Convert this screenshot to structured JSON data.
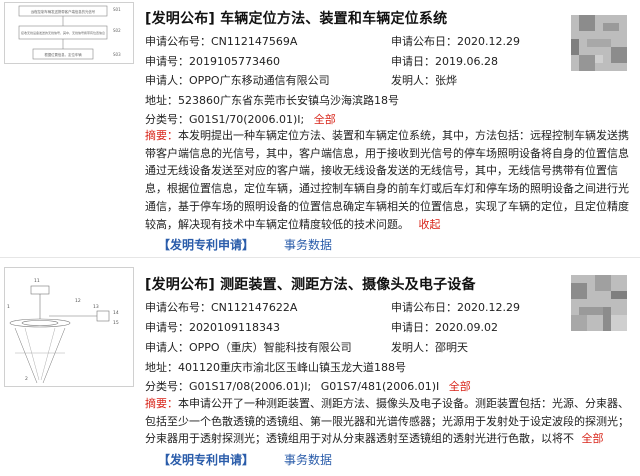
{
  "records": [
    {
      "title": "[发明公布] 车辆定位方法、装置和车辆定位系统",
      "pub_no_label": "申请公布号：",
      "pub_no": "CN112147569A",
      "pub_date_label": "申请公布日：",
      "pub_date": "2020.12.29",
      "app_no_label": "申请号：",
      "app_no": "2019105773460",
      "app_date_label": "申请日：",
      "app_date": "2019.06.28",
      "applicant_label": "申请人：",
      "applicant": "OPPO广东移动通信有限公司",
      "inventor_label": "发明人：",
      "inventor": "张烨",
      "address_label": "地址：",
      "address": "523860广东省东莞市长安镇乌沙海滨路18号",
      "class_label": "分类号：",
      "class": "G01S1/70(2006.01)I;",
      "class_all": "全部",
      "abstract_label": "摘要：",
      "abstract": "本发明提出一种车辆定位方法、装置和车辆定位系统，其中，方法包括：远程控制车辆发送携带客户端信息的光信号，其中，客户端信息，用于接收到光信号的停车场照明设备将自身的位置信息通过无线设备发送至对应的客户端，接收无线设备发送的无线信号，其中，无线信号携带有位置信息，根据位置信息，定位车辆，通过控制车辆自身的前车灯或后车灯和停车场的照明设备之间进行光通信，基于停车场的照明设备的位置信息确定车辆相关的位置信息，实现了车辆的定位，且定位精度较高，解决现有技术中车辆定位精度较低的技术问题。",
      "collapse": "收起",
      "link_apply": "【发明专利申请】",
      "link_affairs": "事务数据",
      "thumb_labels": [
        "S01",
        "S02",
        "S03"
      ],
      "thumb_steps": [
        "远程控制车辆发送携带客户端信息的光信号",
        "接收无线设备发送的无线信号，其中，无线信号携带有位置信息",
        "根据位置信息，定位车辆"
      ]
    },
    {
      "title": "[发明公布] 测距装置、测距方法、摄像头及电子设备",
      "pub_no_label": "申请公布号：",
      "pub_no": "CN112147622A",
      "pub_date_label": "申请公布日：",
      "pub_date": "2020.12.29",
      "app_no_label": "申请号：",
      "app_no": "2020109118343",
      "app_date_label": "申请日：",
      "app_date": "2020.09.02",
      "applicant_label": "申请人：",
      "applicant": "OPPO（重庆）智能科技有限公司",
      "inventor_label": "发明人：",
      "inventor": "邵明天",
      "address_label": "地址：",
      "address": "401120重庆市渝北区玉峰山镇玉龙大道188号",
      "class_label": "分类号：",
      "class": "G01S17/08(2006.01)I;",
      "class2": "G01S7/481(2006.01)I",
      "class_all": "全部",
      "abstract_label": "摘要：",
      "abstract": "本申请公开了一种测距装置、测距方法、摄像头及电子设备。测距装置包括：光源、分束器、包括至少一个色散透镜的透镜组、第一限光器和光谱传感器；光源用于发射处于设定波段的探测光；分束器用于透射探测光；透镜组用于对从分束器透射至透镜组的透射光进行色散，以将不",
      "expand": "全部",
      "link_apply": "【发明专利申请】",
      "link_affairs": "事务数据",
      "thumb_labels": [
        "11",
        "12",
        "13",
        "14",
        "15",
        "1",
        "2"
      ]
    }
  ],
  "colors": {
    "red": "#d8261b",
    "link": "#2a5caa",
    "qr_light": "#bdbdbd",
    "qr_dark": "#8c8c8c"
  }
}
